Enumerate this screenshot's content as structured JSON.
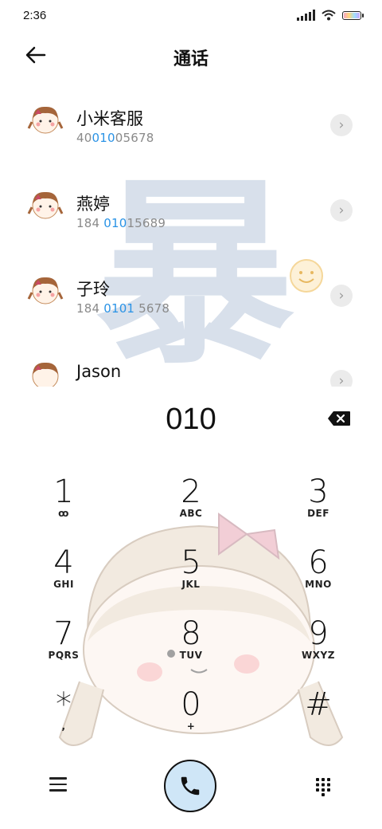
{
  "status": {
    "time": "2:36"
  },
  "header": {
    "title": "通话"
  },
  "watermark": "暴",
  "contacts": [
    {
      "name": "小米客服",
      "num_pre": "40",
      "num_hl": "010",
      "num_post": "05678"
    },
    {
      "name": "燕婷",
      "num_pre": "184 ",
      "num_hl": "010",
      "num_post": "15689"
    },
    {
      "name": "子玲",
      "num_pre": "184 ",
      "num_hl": "0101",
      "num_post": " 5678"
    },
    {
      "name": "Jason",
      "num_pre": "",
      "num_hl": "",
      "num_post": ""
    }
  ],
  "dialer": {
    "input": "010"
  },
  "keys": [
    {
      "digit": "1",
      "letters": "ꝏ"
    },
    {
      "digit": "2",
      "letters": "ABC"
    },
    {
      "digit": "3",
      "letters": "DEF"
    },
    {
      "digit": "4",
      "letters": "GHI"
    },
    {
      "digit": "5",
      "letters": "JKL"
    },
    {
      "digit": "6",
      "letters": "MNO"
    },
    {
      "digit": "7",
      "letters": "PQRS"
    },
    {
      "digit": "8",
      "letters": "TUV"
    },
    {
      "digit": "9",
      "letters": "WXYZ"
    },
    {
      "digit": "*",
      "letters": ","
    },
    {
      "digit": "0",
      "letters": "+"
    },
    {
      "digit": "#",
      "letters": ""
    }
  ],
  "icons": {
    "back": "arrow-left-icon",
    "chevron": "chevron-right-icon",
    "backspace": "backspace-icon",
    "menu": "menu-icon",
    "call": "phone-icon",
    "dialpad": "dialpad-icon"
  },
  "colors": {
    "highlight": "#2a93e6",
    "call_button": "#cfe6f7"
  }
}
